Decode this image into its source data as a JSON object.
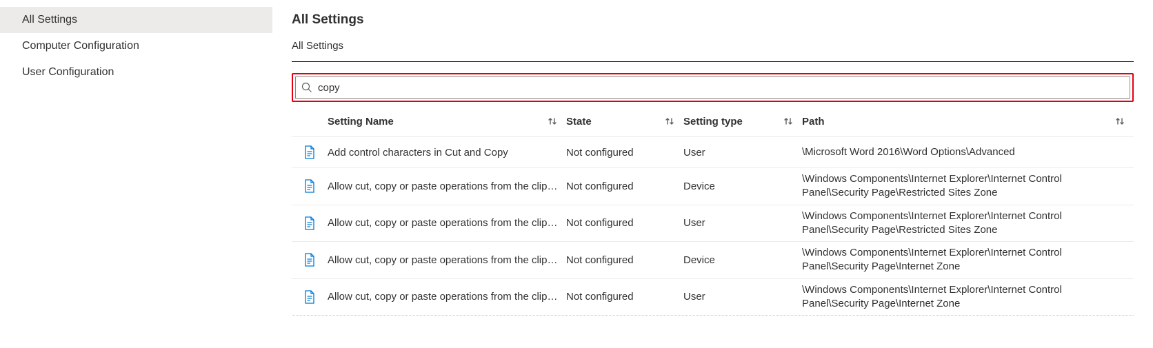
{
  "sidebar": {
    "items": [
      {
        "label": "All Settings",
        "selected": true
      },
      {
        "label": "Computer Configuration",
        "selected": false
      },
      {
        "label": "User Configuration",
        "selected": false
      }
    ]
  },
  "header": {
    "title": "All Settings",
    "breadcrumb": "All Settings"
  },
  "search": {
    "value": "copy",
    "placeholder": ""
  },
  "table": {
    "headers": {
      "name": "Setting Name",
      "state": "State",
      "type": "Setting type",
      "path": "Path"
    },
    "rows": [
      {
        "name": "Add control characters in Cut and Copy",
        "state": "Not configured",
        "type": "User",
        "path": "\\Microsoft Word 2016\\Word Options\\Advanced"
      },
      {
        "name": "Allow cut, copy or paste operations from the clipboard via script",
        "state": "Not configured",
        "type": "Device",
        "path": "\\Windows Components\\Internet Explorer\\Internet Control Panel\\Security Page\\Restricted Sites Zone"
      },
      {
        "name": "Allow cut, copy or paste operations from the clipboard via script",
        "state": "Not configured",
        "type": "User",
        "path": "\\Windows Components\\Internet Explorer\\Internet Control Panel\\Security Page\\Restricted Sites Zone"
      },
      {
        "name": "Allow cut, copy or paste operations from the clipboard via script",
        "state": "Not configured",
        "type": "Device",
        "path": "\\Windows Components\\Internet Explorer\\Internet Control Panel\\Security Page\\Internet Zone"
      },
      {
        "name": "Allow cut, copy or paste operations from the clipboard via script",
        "state": "Not configured",
        "type": "User",
        "path": "\\Windows Components\\Internet Explorer\\Internet Control Panel\\Security Page\\Internet Zone"
      }
    ]
  }
}
